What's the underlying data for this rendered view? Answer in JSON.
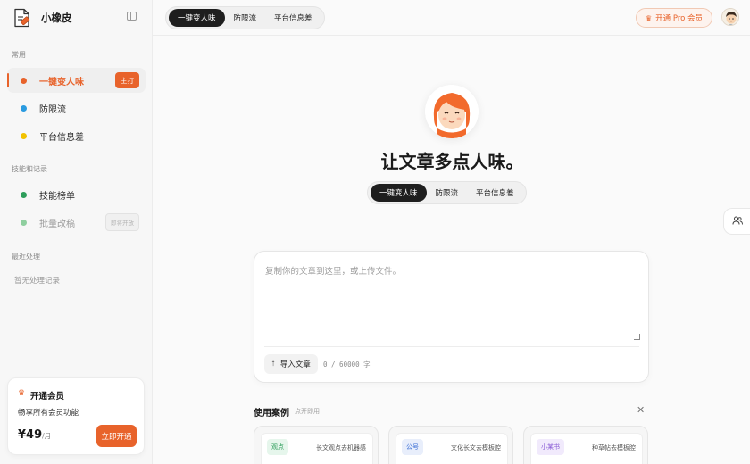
{
  "app": {
    "name": "小橡皮"
  },
  "sidebar": {
    "section_common": "常用",
    "items_common": [
      {
        "label": "一键变人味",
        "badge": "主打",
        "dot_color": "#e8632b",
        "active": true
      },
      {
        "label": "防限流",
        "dot_color": "#2a9be0"
      },
      {
        "label": "平台信息差",
        "dot_color": "#f2c200"
      }
    ],
    "section_skills": "技能和记录",
    "items_skills": [
      {
        "label": "技能榜单",
        "dot_color": "#2e9e5b"
      },
      {
        "label": "批量改稿",
        "badge": "即将开放",
        "dot_color": "#8fcf9f",
        "disabled": true
      }
    ],
    "section_recent": "最近处理",
    "recent_empty": "暂无处理记录",
    "member": {
      "title": "开通会员",
      "desc": "畅享所有会员功能",
      "price": "¥49",
      "unit": "/月",
      "button": "立即开通"
    }
  },
  "topbar": {
    "tabs": [
      "一键变人味",
      "防限流",
      "平台信息差"
    ],
    "active_tab": 0,
    "pro_button": "开通 Pro 会员"
  },
  "main": {
    "headline": "让文章多点人味。",
    "mode_tabs": [
      "一键变人味",
      "防限流",
      "平台信息差"
    ],
    "editor": {
      "placeholder": "复制你的文章到这里，或上传文件。",
      "import_label": "导入文章",
      "char_count": "0 / 60000 字"
    },
    "cases": {
      "title": "使用案例",
      "hint": "点开即用",
      "items": [
        {
          "tag": "观点",
          "name": "长文观点去机器感",
          "tag_color": "#2e9e5b",
          "tag_bg": "#e6f6ec"
        },
        {
          "tag": "公号",
          "name": "文化长文去模板腔",
          "tag_color": "#3b6fd6",
          "tag_bg": "#e8eefb"
        },
        {
          "tag": "小某书",
          "name": "种草帖去模板腔",
          "tag_color": "#8a5cd6",
          "tag_bg": "#f1eafc"
        }
      ]
    }
  },
  "colors": {
    "accent": "#e8632b",
    "dark": "#1e1e1e"
  },
  "icons": [
    "document-logo-icon",
    "sidebar-collapse-icon",
    "crown-icon",
    "upload-icon",
    "close-icon",
    "users-icon",
    "avatar-icon"
  ]
}
